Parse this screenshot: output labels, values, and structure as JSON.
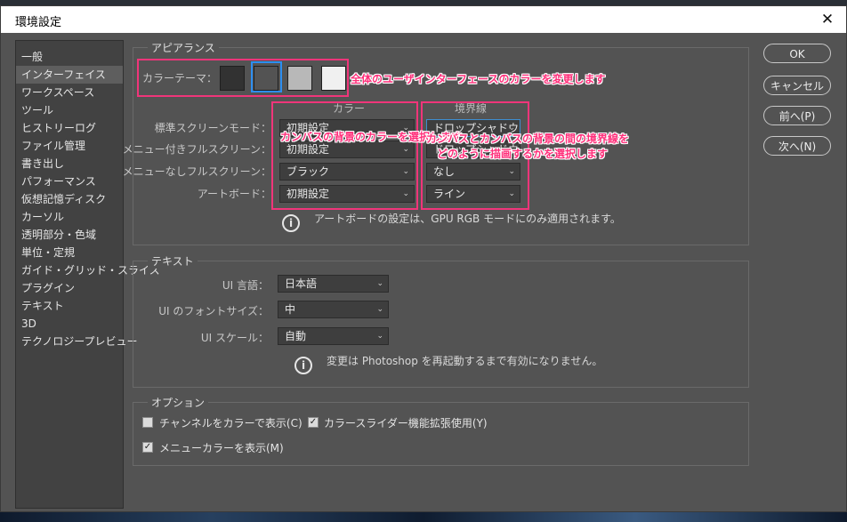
{
  "window": {
    "title": "環境設定",
    "close": "✕"
  },
  "sidebar": {
    "items": [
      {
        "label": "一般"
      },
      {
        "label": "インターフェイス",
        "selected": true
      },
      {
        "label": "ワークスペース"
      },
      {
        "label": "ツール"
      },
      {
        "label": "ヒストリーログ"
      },
      {
        "label": "ファイル管理"
      },
      {
        "label": "書き出し"
      },
      {
        "label": "パフォーマンス"
      },
      {
        "label": "仮想記憶ディスク"
      },
      {
        "label": "カーソル"
      },
      {
        "label": "透明部分・色域"
      },
      {
        "label": "単位・定規"
      },
      {
        "label": "ガイド・グリッド・スライス"
      },
      {
        "label": "プラグイン"
      },
      {
        "label": "テキスト"
      },
      {
        "label": "3D"
      },
      {
        "label": "テクノロジープレビュー"
      }
    ]
  },
  "buttons": {
    "ok": "OK",
    "cancel": "キャンセル",
    "prev": "前へ(P)",
    "next": "次へ(N)"
  },
  "appearance": {
    "title": "アピアランス",
    "color_theme_label": "カラーテーマ：",
    "swatch_colors": [
      "#323232",
      "#535353",
      "#b8b8b8",
      "#f0f0f0"
    ],
    "col_color": "カラー",
    "col_border": "境界線",
    "rows": [
      {
        "label": "標準スクリーンモード：",
        "color": "初期設定",
        "border": "ドロップシャドウ"
      },
      {
        "label": "メニュー付きフルスクリーン：",
        "color": "初期設定",
        "border": "ドロップシャドウ"
      },
      {
        "label": "メニューなしフルスクリーン：",
        "color": "ブラック",
        "border": "なし"
      },
      {
        "label": "アートボード：",
        "color": "初期設定",
        "border": "ライン"
      }
    ],
    "info": "アートボードの設定は、GPU RGB モードにのみ適用されます。"
  },
  "text_section": {
    "title": "テキスト",
    "ui_language_label": "UI 言語：",
    "ui_language": "日本語",
    "ui_font_size_label": "UI のフォントサイズ：",
    "ui_font_size": "中",
    "ui_scale_label": "UI スケール：",
    "ui_scale": "自動",
    "info": "変更は Photoshop を再起動するまで有効になりません。"
  },
  "options": {
    "title": "オプション",
    "channels_color": "チャンネルをカラーで表示(C)",
    "channels_color_checked": false,
    "color_slider": "カラースライダー機能拡張使用(Y)",
    "color_slider_checked": true,
    "menu_color": "メニューカラーを表示(M)",
    "menu_color_checked": true
  },
  "annotations": {
    "theme": "全体のユーザインターフェースのカラーを変更します",
    "color": "カンバスの背景のカラーを選択します",
    "border_line1": "カンバスとカンバスの背景の間の境界線を",
    "border_line2": "どのように描画するかを選択します",
    "accent": "#f0357a"
  },
  "icons": {
    "info": "i",
    "chevron": "⌄",
    "check": "✓"
  }
}
